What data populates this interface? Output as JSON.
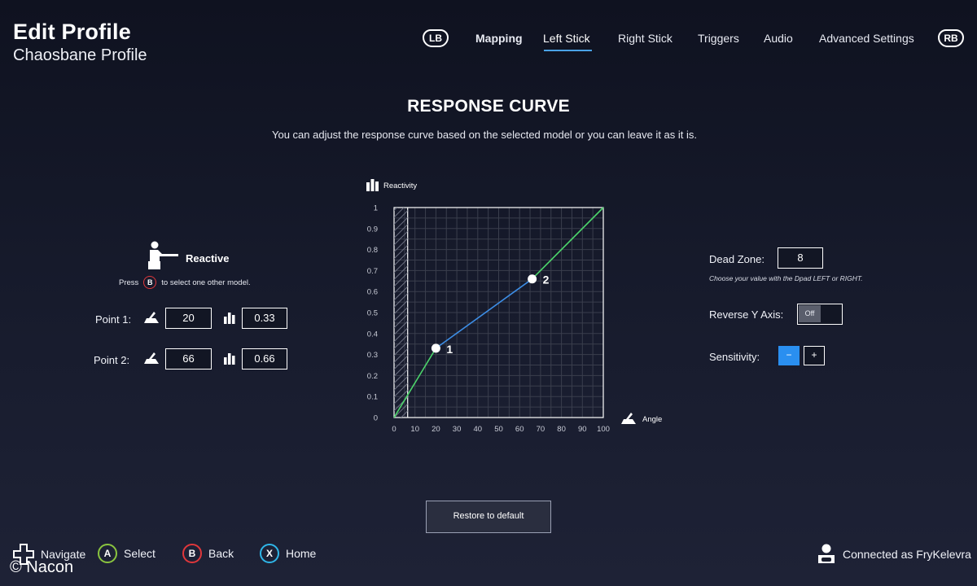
{
  "header": {
    "title": "Edit Profile",
    "subtitle": "Chaosbane Profile"
  },
  "nav": {
    "left_bumper": "LB",
    "right_bumper": "RB",
    "tabs": [
      {
        "label": "Mapping"
      },
      {
        "label": "Left Stick"
      },
      {
        "label": "Right Stick"
      },
      {
        "label": "Triggers"
      },
      {
        "label": "Audio"
      },
      {
        "label": "Advanced Settings"
      }
    ],
    "active_tab": "Left Stick"
  },
  "section": {
    "title": "RESPONSE CURVE",
    "description": "You can adjust the response curve based on the selected model or you can leave it as it is."
  },
  "model": {
    "icon": "rifle-shooter-icon",
    "name": "Reactive",
    "press_prefix": "Press",
    "press_button": "B",
    "press_suffix": "to select one other model."
  },
  "points": {
    "point1_label": "Point 1:",
    "point1_angle": "20",
    "point1_reactivity": "0.33",
    "point2_label": "Point 2:",
    "point2_angle": "66",
    "point2_reactivity": "0.66"
  },
  "settings": {
    "dead_zone_label": "Dead Zone:",
    "dead_zone_value": "8",
    "dead_zone_hint": "Choose your value with the Dpad LEFT or RIGHT.",
    "reverse_y_label": "Reverse Y Axis:",
    "reverse_y_value": "Off",
    "sensitivity_label": "Sensitivity:",
    "sensitivity_minus": "−",
    "sensitivity_plus": "+"
  },
  "restore_label": "Restore to default",
  "footer": {
    "navigate": "Navigate",
    "select_button": "A",
    "select": "Select",
    "back_button": "B",
    "back": "Back",
    "home_button": "X",
    "home": "Home",
    "connected": "Connected as FryKelevra",
    "copyright": "© Nacon"
  },
  "colors": {
    "accent_blue": "#2a8ff0",
    "curve_green": "#4cd66b",
    "curve_blue": "#3d8ee6",
    "button_a": "#8ac43f",
    "button_b": "#e0373b",
    "button_x": "#2fb6e8"
  },
  "chart_data": {
    "type": "line",
    "ylabel": "Reactivity",
    "xlabel": "Angle",
    "xlim": [
      0,
      100
    ],
    "ylim": [
      0,
      1
    ],
    "x_ticks": [
      "0",
      "10",
      "20",
      "30",
      "40",
      "50",
      "60",
      "70",
      "80",
      "90",
      "100"
    ],
    "y_ticks": [
      "0",
      "0.1",
      "0.2",
      "0.3",
      "0.4",
      "0.5",
      "0.6",
      "0.7",
      "0.8",
      "0.9",
      "1"
    ],
    "dead_zone": 6.5,
    "grid": true,
    "series": [
      {
        "color": "#4cd66b",
        "x": [
          0,
          20
        ],
        "y": [
          0,
          0.33
        ]
      },
      {
        "color": "#3d8ee6",
        "x": [
          20,
          66
        ],
        "y": [
          0.33,
          0.66
        ]
      },
      {
        "color": "#4cd66b",
        "x": [
          66,
          100
        ],
        "y": [
          0.66,
          1
        ]
      }
    ],
    "control_points": [
      {
        "label": "1",
        "x": 20,
        "y": 0.33
      },
      {
        "label": "2",
        "x": 66,
        "y": 0.66
      }
    ]
  }
}
